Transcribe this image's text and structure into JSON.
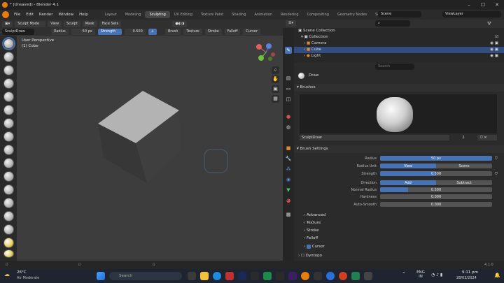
{
  "window": {
    "title": "* [Unsaved] - Blender 4.1"
  },
  "menu": [
    "File",
    "Edit",
    "Render",
    "Window",
    "Help"
  ],
  "workspaces": [
    "Layout",
    "Modeling",
    "Sculpting",
    "UV Editing",
    "Texture Paint",
    "Shading",
    "Animation",
    "Rendering",
    "Compositing",
    "Geometry Nodes",
    "Scripting"
  ],
  "active_workspace": "Sculpting",
  "scene": {
    "label": "Scene",
    "view_layer": "ViewLayer"
  },
  "header": {
    "mode": "Sculpt Mode",
    "menus": [
      "View",
      "Sculpt",
      "Mask",
      "Face Sets"
    ],
    "brush_name": "SculptDraw",
    "radius_label": "Radius",
    "radius_value": "50 px",
    "strength_label": "Strength",
    "strength_value": "0.500",
    "right_menus": [
      "Brush",
      "Texture",
      "Stroke",
      "Falloff",
      "Cursor"
    ]
  },
  "viewport": {
    "perspective": "User Perspective",
    "object": "(1) Cube",
    "gizmo_axes": [
      "X",
      "Y",
      "Z"
    ]
  },
  "outliner": {
    "title": "Scene Collection",
    "rows": [
      "Collection",
      "Camera",
      "Cube",
      "Light"
    ],
    "selected": "Cube"
  },
  "properties": {
    "brush_title": "Draw",
    "brushes_panel": "Brushes",
    "brush_field": "SculptDraw",
    "brush_users": "2",
    "brush_settings_panel": "Brush Settings",
    "rows": [
      {
        "label": "Radius",
        "value": "50 px",
        "fill": 1.0
      },
      {
        "label": "Radius Unit",
        "value": "View",
        "value2": "Scene",
        "fill": 0.5
      },
      {
        "label": "Strength",
        "value": "0.500",
        "fill": 0.5
      },
      {
        "label": "Direction",
        "value": "Add",
        "value2": "Subtract",
        "fill": 0.5
      },
      {
        "label": "Normal Radius",
        "value": "0.500",
        "fill": 0.25
      },
      {
        "label": "Hardness",
        "value": "0.000",
        "fill": 0.0
      },
      {
        "label": "Auto-Smooth",
        "value": "0.000",
        "fill": 0.0
      }
    ],
    "subpanels": [
      "Advanced",
      "Texture",
      "Stroke",
      "Falloff",
      "Cursor",
      "Dyntopo"
    ],
    "search_placeholder": "Search"
  },
  "status": {
    "version": "4.1.0"
  },
  "taskbar": {
    "weather_temp": "26°C",
    "weather_text": "Air Moderate",
    "search_placeholder": "Search",
    "lang": "ENG",
    "region": "IN",
    "time": "9:11 pm",
    "date": "28/03/2024"
  }
}
